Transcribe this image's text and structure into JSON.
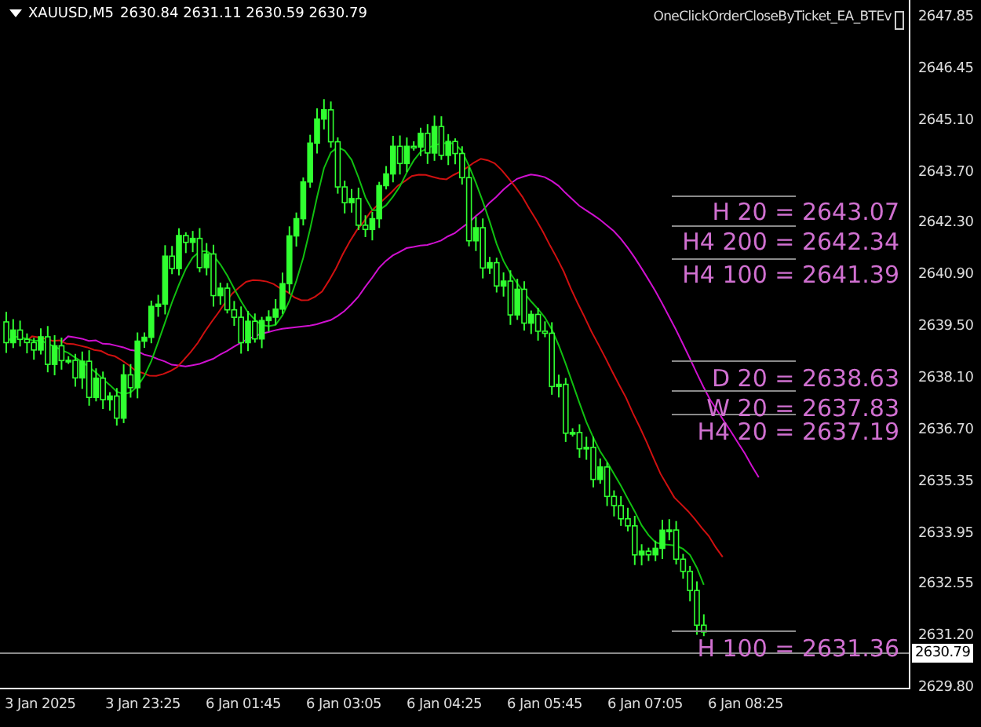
{
  "chart": {
    "symbol": "XAUUSD,M5",
    "quote": "2630.84 2631.11 2630.59 2630.79",
    "expert_name": "OneClickOrderCloseByTicket_EA_BTEv",
    "price_axis": [
      "2647.85",
      "2646.45",
      "2645.10",
      "2643.70",
      "2642.30",
      "2640.90",
      "2639.50",
      "2638.10",
      "2636.70",
      "2635.35",
      "2633.95",
      "2632.55",
      "2631.20",
      "2629.80"
    ],
    "current_price": "2630.79",
    "time_axis": [
      "3 Jan 2025",
      "3 Jan 23:25",
      "6 Jan 01:45",
      "6 Jan 03:05",
      "6 Jan 04:25",
      "6 Jan 05:45",
      "6 Jan 07:05",
      "6 Jan 08:25"
    ],
    "levels": [
      {
        "label": "H 20 = 2643.07"
      },
      {
        "label": "H4 200 = 2642.34"
      },
      {
        "label": "H4 100 = 2641.39"
      },
      {
        "label": "D 20 = 2638.63"
      },
      {
        "label": "W 20 = 2637.83"
      },
      {
        "label": "H4 20 = 2637.19"
      },
      {
        "label": "H 100 = 2631.36"
      }
    ]
  }
}
